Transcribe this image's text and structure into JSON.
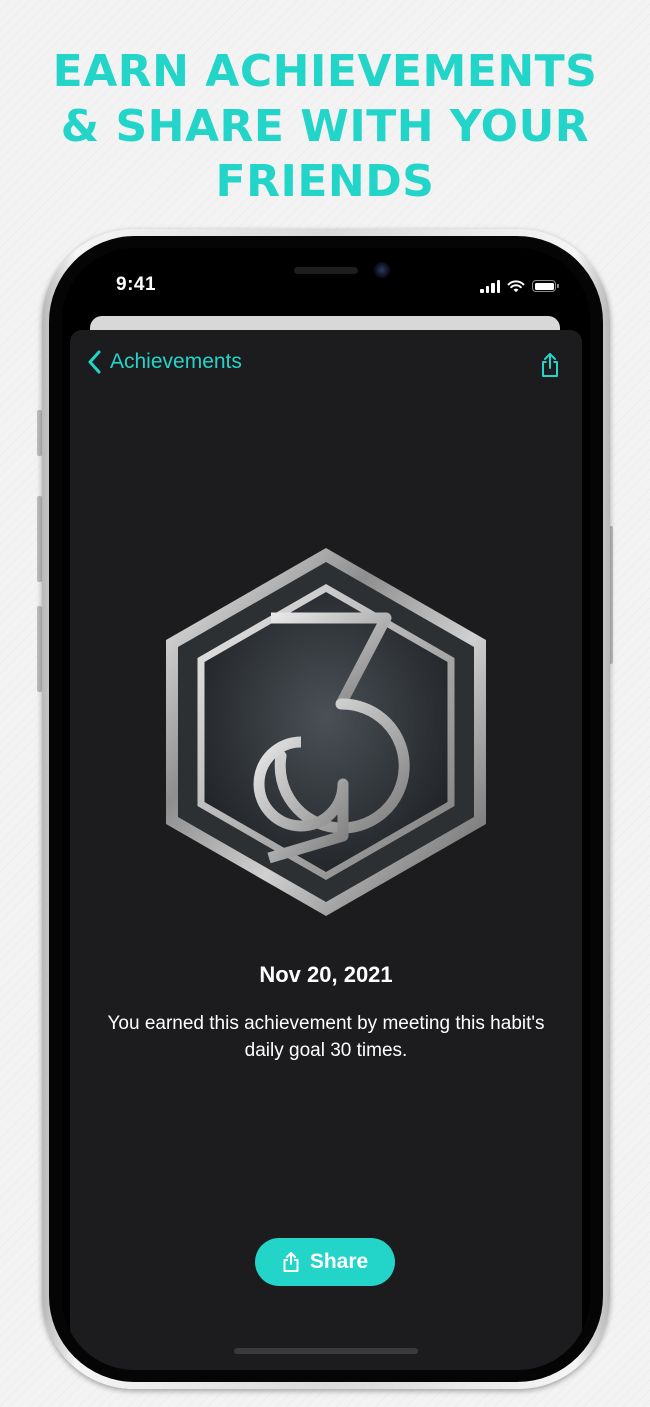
{
  "headline": {
    "lines": [
      "EARN ACHIEVEMENTS",
      "& SHARE WITH YOUR",
      "FRIENDS"
    ],
    "color": "#23d4c8"
  },
  "status_bar": {
    "time": "9:41",
    "icons": [
      "cellular-signal-icon",
      "wifi-icon",
      "battery-icon"
    ]
  },
  "nav": {
    "back_label": "Achievements",
    "back_icon": "chevron-left-icon",
    "action_icon": "share-icon"
  },
  "achievement": {
    "badge_icon": "hexagon-30-badge-icon",
    "date": "Nov 20, 2021",
    "description": "You earned this achievement by meeting this habit's daily goal 30 times."
  },
  "share_button": {
    "label": "Share",
    "icon": "share-icon"
  },
  "colors": {
    "accent": "#23d4c8",
    "sheet_background": "#1c1c1e",
    "page_background": "#f3f3f3"
  }
}
